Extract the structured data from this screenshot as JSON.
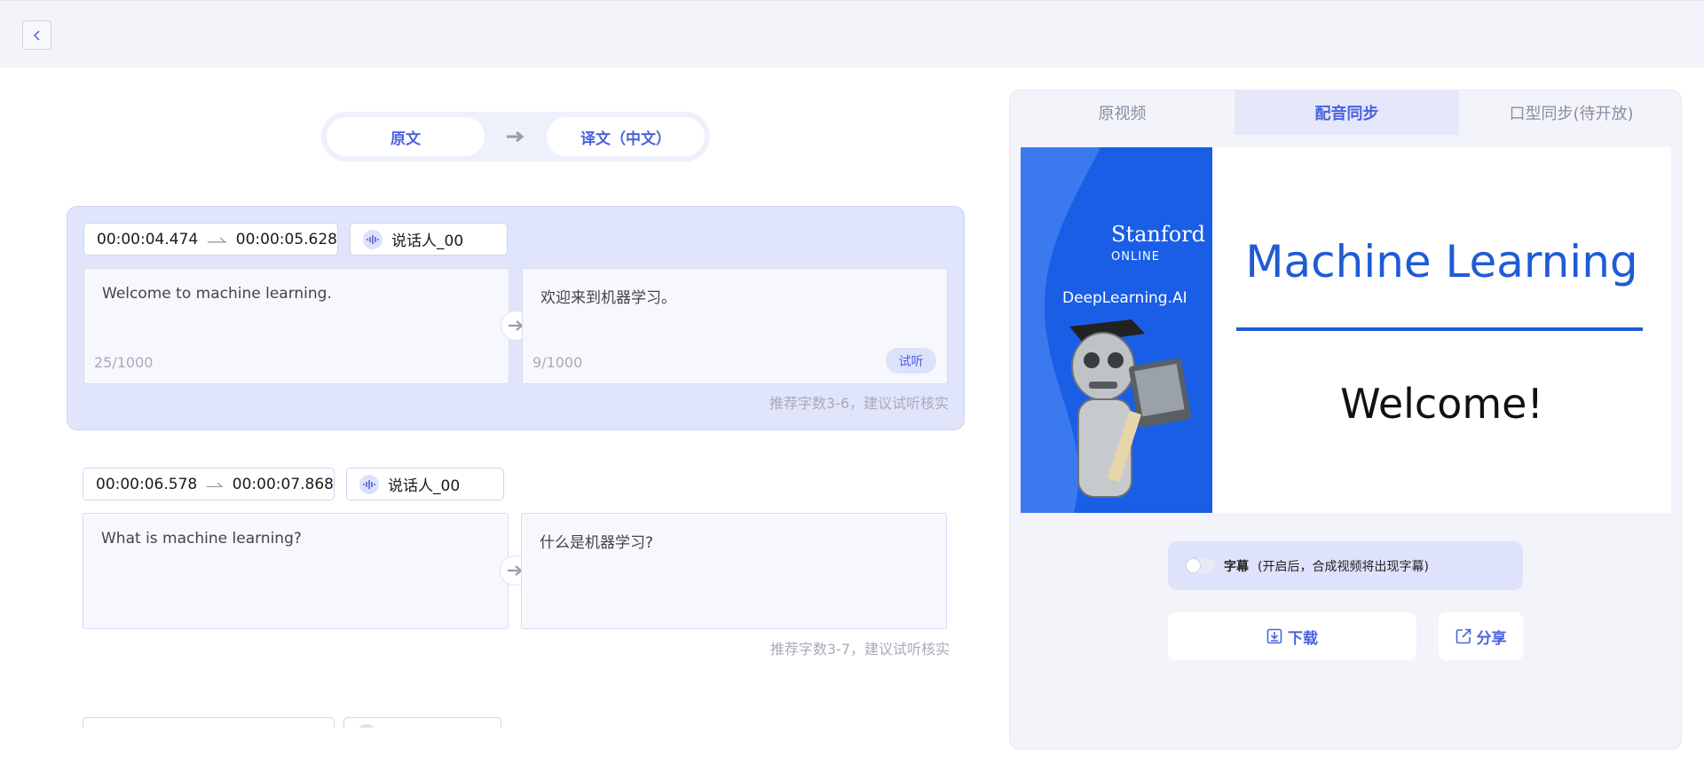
{
  "lang_toggle": {
    "source_label": "原文",
    "target_label": "译文（中文）"
  },
  "segments": [
    {
      "start": "00:00:04.474",
      "end": "00:00:05.628",
      "speaker": "说话人_00",
      "source_text": "Welcome to machine learning.",
      "source_count": "25/1000",
      "target_text": "欢迎来到机器学习。",
      "target_count": "9/1000",
      "listen_label": "试听",
      "hint": "推荐字数3-6，建议试听核实"
    },
    {
      "start": "00:00:06.578",
      "end": "00:00:07.868",
      "speaker": "说话人_00",
      "source_text": "What is machine learning?",
      "target_text": "什么是机器学习?",
      "hint": "推荐字数3-7，建议试听核实"
    }
  ],
  "right_panel": {
    "tabs": [
      "原视频",
      "配音同步",
      "口型同步(待开放)"
    ],
    "active_tab": 1,
    "video": {
      "stanford": "Stanford",
      "online": "ONLINE",
      "dlai": "DeepLearning.AI",
      "title": "Machine Learning",
      "welcome": "Welcome!"
    },
    "subtitle_label": "字幕",
    "subtitle_note": "(开启后，合成视频将出现字幕)",
    "download_label": "下载",
    "share_label": "分享"
  },
  "colors": {
    "accent": "#4b62e0",
    "video_blue": "#1a5ee6",
    "active_bg": "#e1e5fb"
  },
  "icons": [
    "back-chevron-icon",
    "arrow-right-icon",
    "audio-wave-icon",
    "download-icon",
    "share-icon"
  ]
}
